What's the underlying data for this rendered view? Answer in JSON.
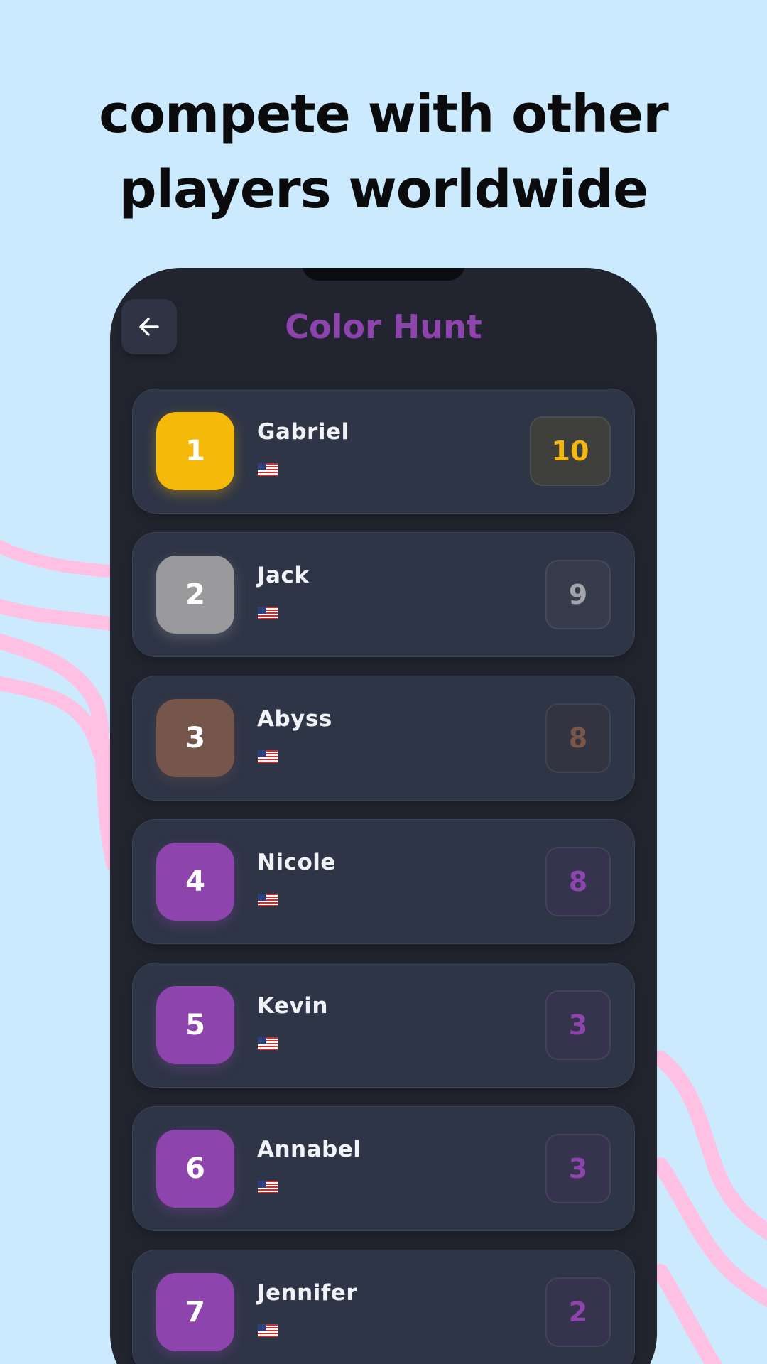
{
  "headline": {
    "line1": "compete with other",
    "line2": "players worldwide"
  },
  "app": {
    "title": "Color Hunt",
    "title_color": "#8e44ad",
    "back_icon": "arrow-left-icon"
  },
  "leaderboard": [
    {
      "rank": "1",
      "name": "Gabriel",
      "flag": "us-flag-icon",
      "score": "10",
      "rank_color": "#f5b90a",
      "score_color": "#f4b70f",
      "score_bg": "#3f3f3e"
    },
    {
      "rank": "2",
      "name": "Jack",
      "flag": "us-flag-icon",
      "score": "9",
      "rank_color": "#9a9a9c",
      "score_color": "#a3a5aa",
      "score_bg": "#363c4c"
    },
    {
      "rank": "3",
      "name": "Abyss",
      "flag": "us-flag-icon",
      "score": "8",
      "rank_color": "#76554a",
      "score_color": "#7a5648",
      "score_bg": "#323442"
    },
    {
      "rank": "4",
      "name": "Nicole",
      "flag": "us-flag-icon",
      "score": "8",
      "rank_color": "#8e44ad",
      "score_color": "#8e44ad",
      "score_bg": "#35334e"
    },
    {
      "rank": "5",
      "name": "Kevin",
      "flag": "us-flag-icon",
      "score": "3",
      "rank_color": "#8e44ad",
      "score_color": "#8e44ad",
      "score_bg": "#35334e"
    },
    {
      "rank": "6",
      "name": "Annabel",
      "flag": "us-flag-icon",
      "score": "3",
      "rank_color": "#8e44ad",
      "score_color": "#8e44ad",
      "score_bg": "#35334e"
    },
    {
      "rank": "7",
      "name": "Jennifer",
      "flag": "us-flag-icon",
      "score": "2",
      "rank_color": "#8e44ad",
      "score_color": "#8e44ad",
      "score_bg": "#35334e"
    }
  ],
  "colors": {
    "background": "#cbeafd",
    "wave": "#ffc1e3",
    "phone": "#22252f",
    "row": "#2e3546"
  }
}
